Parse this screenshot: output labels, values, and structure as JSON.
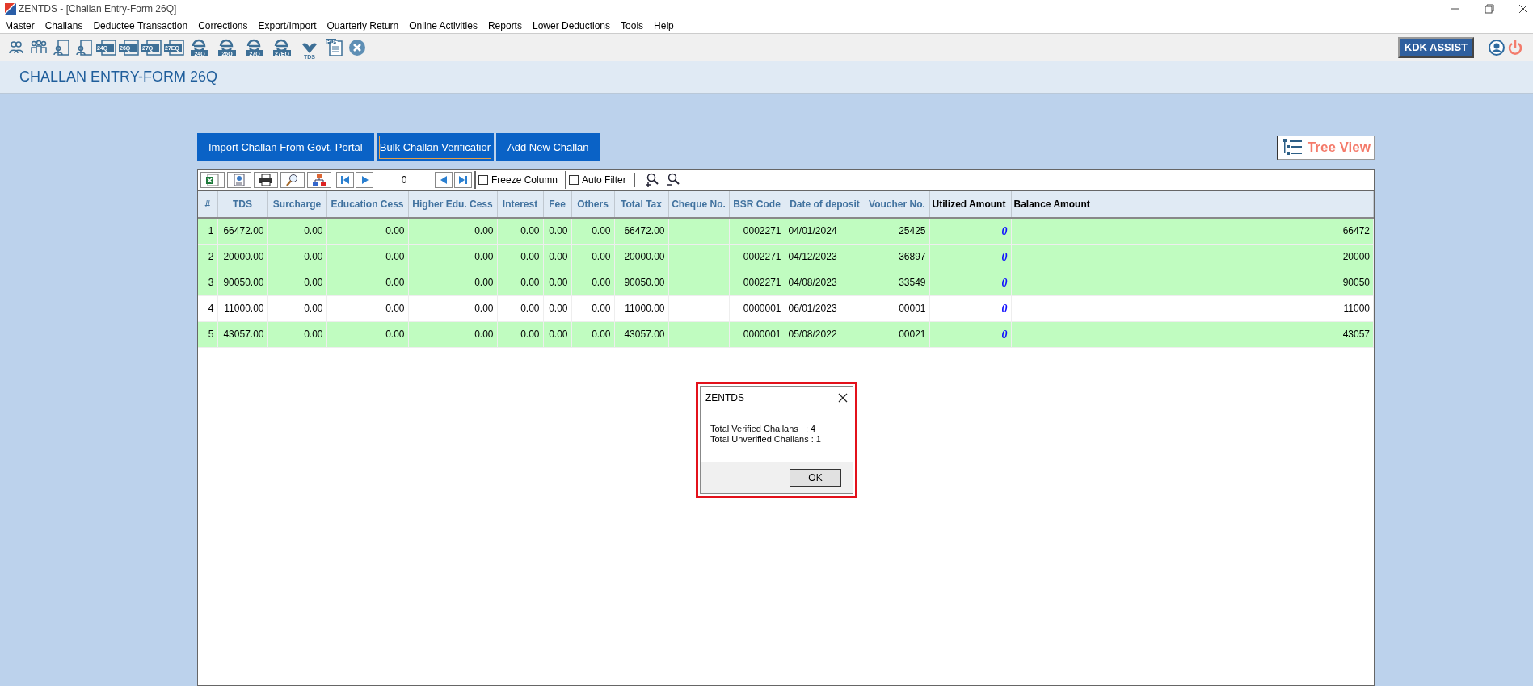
{
  "window": {
    "title": "ZENTDS - [Challan Entry-Form 26Q]"
  },
  "menu": [
    "Master",
    "Challans",
    "Deductee Transaction",
    "Corrections",
    "Export/Import",
    "Quarterly Return",
    "Online Activities",
    "Reports",
    "Lower Deductions",
    "Tools",
    "Help"
  ],
  "toolbar": [
    {
      "kind": "user"
    },
    {
      "kind": "users"
    },
    {
      "kind": "form"
    },
    {
      "kind": "form"
    },
    {
      "kind": "return",
      "label": "24Q"
    },
    {
      "kind": "return",
      "label": "26Q"
    },
    {
      "kind": "return",
      "label": "27Q"
    },
    {
      "kind": "return",
      "label": "27EQ"
    },
    {
      "kind": "efile",
      "label": "24Q"
    },
    {
      "kind": "efile",
      "label": "26Q"
    },
    {
      "kind": "efile",
      "label": "27Q"
    },
    {
      "kind": "efile",
      "label": "27EQ"
    },
    {
      "kind": "tds",
      "label": "TDS"
    },
    {
      "kind": "pdf",
      "label": "PDF"
    },
    {
      "kind": "close"
    }
  ],
  "assist_button": "KDK ASSIST",
  "page_title": "CHALLAN ENTRY-FORM 26Q",
  "actions": [
    {
      "label": "Import Challan From Govt. Portal",
      "focused": false
    },
    {
      "label": "Bulk Challan Verificatior",
      "focused": true
    },
    {
      "label": "Add New Challan",
      "focused": false
    }
  ],
  "tree_view_button": "Tree View",
  "grid_toolbar": {
    "page": "0",
    "options": [
      {
        "label": "Freeze Column",
        "checked": false
      },
      {
        "label": "Auto Filter",
        "checked": false
      }
    ]
  },
  "table": {
    "columns": [
      {
        "label": "#",
        "kind": "field"
      },
      {
        "label": "TDS",
        "kind": "field"
      },
      {
        "label": "Surcharge",
        "kind": "field"
      },
      {
        "label": "Education Cess",
        "kind": "field"
      },
      {
        "label": "Higher Edu. Cess",
        "kind": "field"
      },
      {
        "label": "Interest",
        "kind": "field"
      },
      {
        "label": "Fee",
        "kind": "field"
      },
      {
        "label": "Others",
        "kind": "field"
      },
      {
        "label": "Total Tax",
        "kind": "field"
      },
      {
        "label": "Cheque No.",
        "kind": "field"
      },
      {
        "label": "BSR Code",
        "kind": "field"
      },
      {
        "label": "Date of deposit",
        "kind": "field"
      },
      {
        "label": "Voucher No.",
        "kind": "field"
      },
      {
        "label": "Utilized Amount",
        "kind": "utilized"
      },
      {
        "label": "Balance Amount",
        "kind": "balance"
      }
    ],
    "rows": [
      {
        "verified": true,
        "cells": [
          "1",
          "66472.00",
          "0.00",
          "0.00",
          "0.00",
          "0.00",
          "0.00",
          "0.00",
          "66472.00",
          "",
          "0002271",
          "04/01/2024",
          "25425",
          "0",
          "66472"
        ]
      },
      {
        "verified": true,
        "cells": [
          "2",
          "20000.00",
          "0.00",
          "0.00",
          "0.00",
          "0.00",
          "0.00",
          "0.00",
          "20000.00",
          "",
          "0002271",
          "04/12/2023",
          "36897",
          "0",
          "20000"
        ]
      },
      {
        "verified": true,
        "cells": [
          "3",
          "90050.00",
          "0.00",
          "0.00",
          "0.00",
          "0.00",
          "0.00",
          "0.00",
          "90050.00",
          "",
          "0002271",
          "04/08/2023",
          "33549",
          "0",
          "90050"
        ]
      },
      {
        "verified": false,
        "cells": [
          "4",
          "11000.00",
          "0.00",
          "0.00",
          "0.00",
          "0.00",
          "0.00",
          "0.00",
          "11000.00",
          "",
          "0000001",
          "06/01/2023",
          "00001",
          "0",
          "11000"
        ]
      },
      {
        "verified": true,
        "cells": [
          "5",
          "43057.00",
          "0.00",
          "0.00",
          "0.00",
          "0.00",
          "0.00",
          "0.00",
          "43057.00",
          "",
          "0000001",
          "05/08/2022",
          "00021",
          "0",
          "43057"
        ]
      }
    ]
  },
  "dialog": {
    "title": "ZENTDS",
    "highlighted": true,
    "lines": [
      "Total Verified Challans   : 4",
      "Total Unverified Challans : 1"
    ],
    "button": "OK"
  }
}
